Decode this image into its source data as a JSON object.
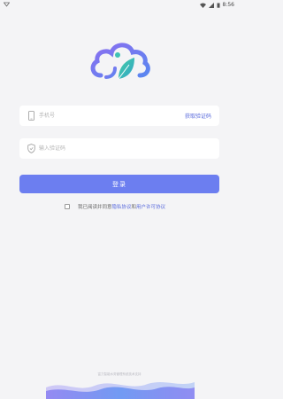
{
  "status_bar": {
    "time": "8:56",
    "icons": [
      "notification-icon",
      "wifi-icon",
      "signal-icon",
      "battery-icon"
    ]
  },
  "logo": {
    "icon": "cloud-leaf-logo",
    "colors": [
      "#6c7ef0",
      "#3fc2b5"
    ]
  },
  "phone_field": {
    "icon": "phone-icon",
    "placeholder": "手机号",
    "value": "",
    "get_code_label": "获取验证码"
  },
  "code_field": {
    "icon": "shield-icon",
    "placeholder": "输入验证码",
    "value": ""
  },
  "login_button": {
    "label": "登录",
    "color": "#6c7ef0"
  },
  "agreement": {
    "checked": false,
    "prefix": "我已阅读并同意",
    "privacy_link": "隐私协议",
    "conjunction": "和",
    "user_link": "用户许可协议"
  },
  "footer": {
    "text": "富力智能水务管理系统技术支持"
  },
  "colors": {
    "accent": "#6c7ef0",
    "link": "#5a6bdc",
    "background": "#f4f4f6"
  }
}
